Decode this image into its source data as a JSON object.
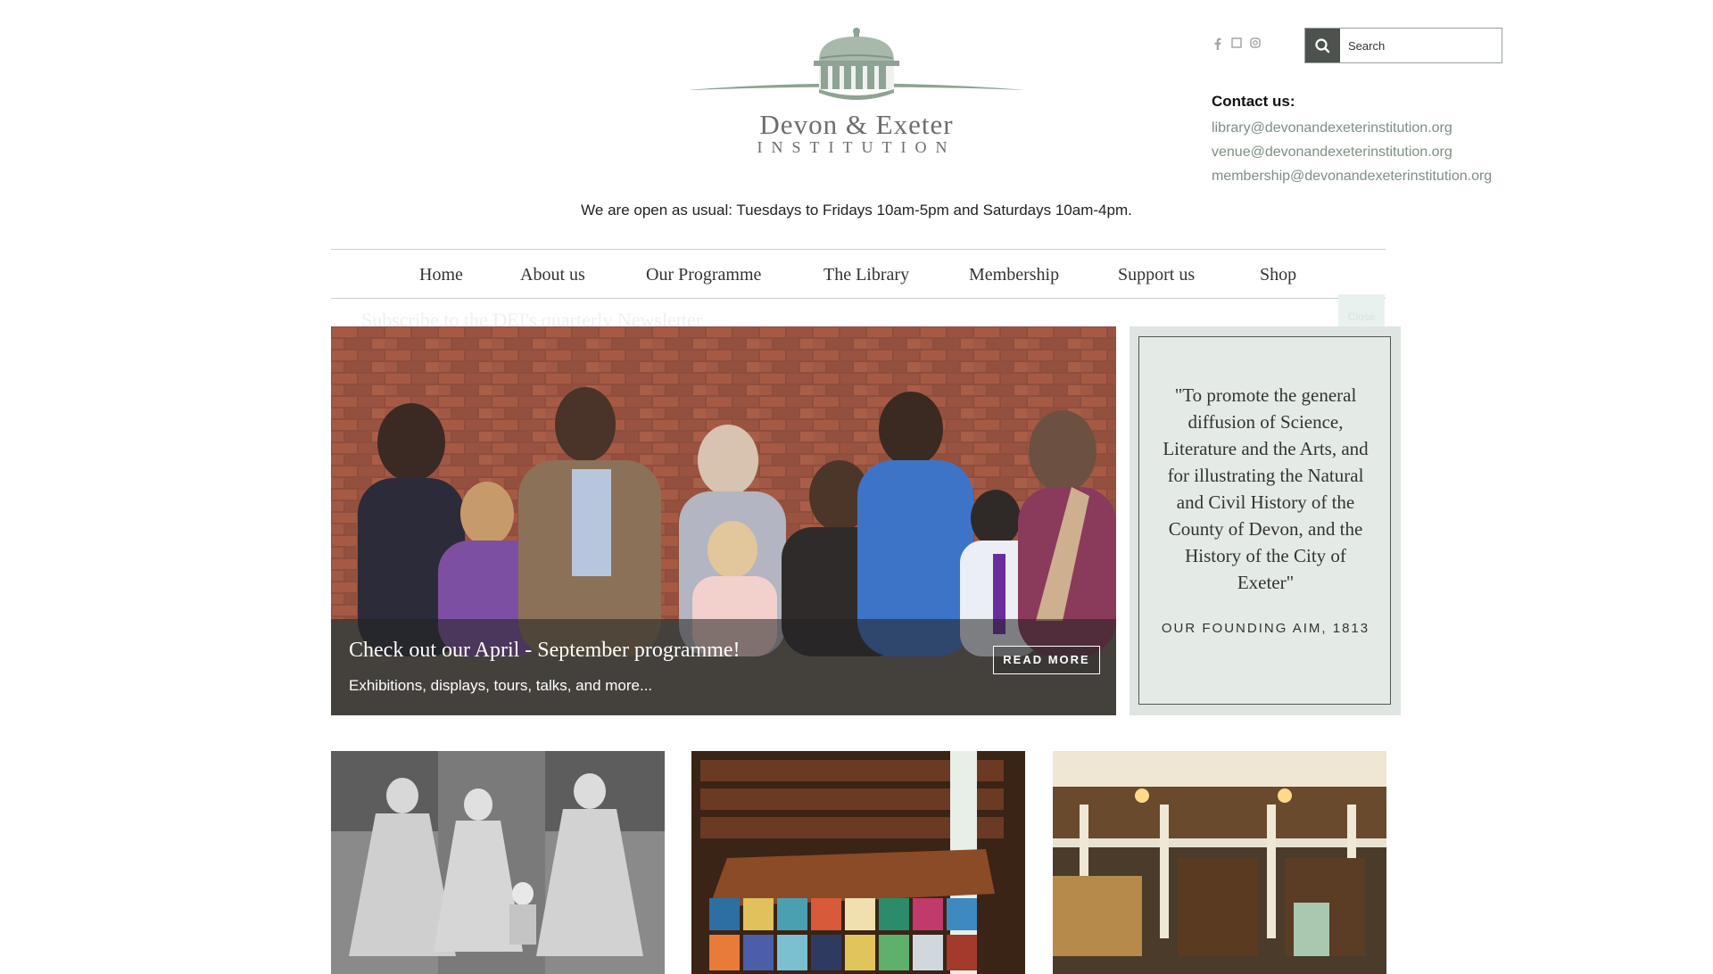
{
  "brand": {
    "logo_line1": "Devon & Exeter",
    "logo_line2": "INSTITUTION",
    "colors": {
      "accent": "#7d8f82",
      "logo": "#8ea393",
      "panel": "#dfe5e1"
    }
  },
  "social": {
    "icons": [
      "facebook-icon",
      "twitter-icon",
      "instagram-icon"
    ]
  },
  "search": {
    "placeholder": "Search",
    "icon": "search-icon"
  },
  "contact": {
    "title": "Contact us:",
    "emails": [
      "library@devonandexeterinstitution.org",
      "venue@devonandexeterinstitution.org",
      "membership@devonandexeterinstitution.org"
    ]
  },
  "opening_hours": "We are open as usual: Tuesdays to Fridays 10am-5pm and Saturdays 10am-4pm.",
  "nav": {
    "items": [
      "Home",
      "About us",
      "Our Programme",
      "The Library",
      "Membership",
      "Support us",
      "Shop"
    ]
  },
  "newsletter_overlay": {
    "text": "Subscribe to the DEI's quarterly Newsletter",
    "close_label": "Close"
  },
  "hero": {
    "title": "Check out our April - September programme!",
    "subtitle": "Exhibitions, displays, tours, talks, and more...",
    "button": "READ MORE"
  },
  "quote": {
    "text": "\"To promote the general diffusion of Science, Literature and the Arts, and for illustrating the Natural and Civil History of the County of Devon, and the History of the City of Exeter\"",
    "source": "OUR FOUNDING AIM, 1813"
  }
}
